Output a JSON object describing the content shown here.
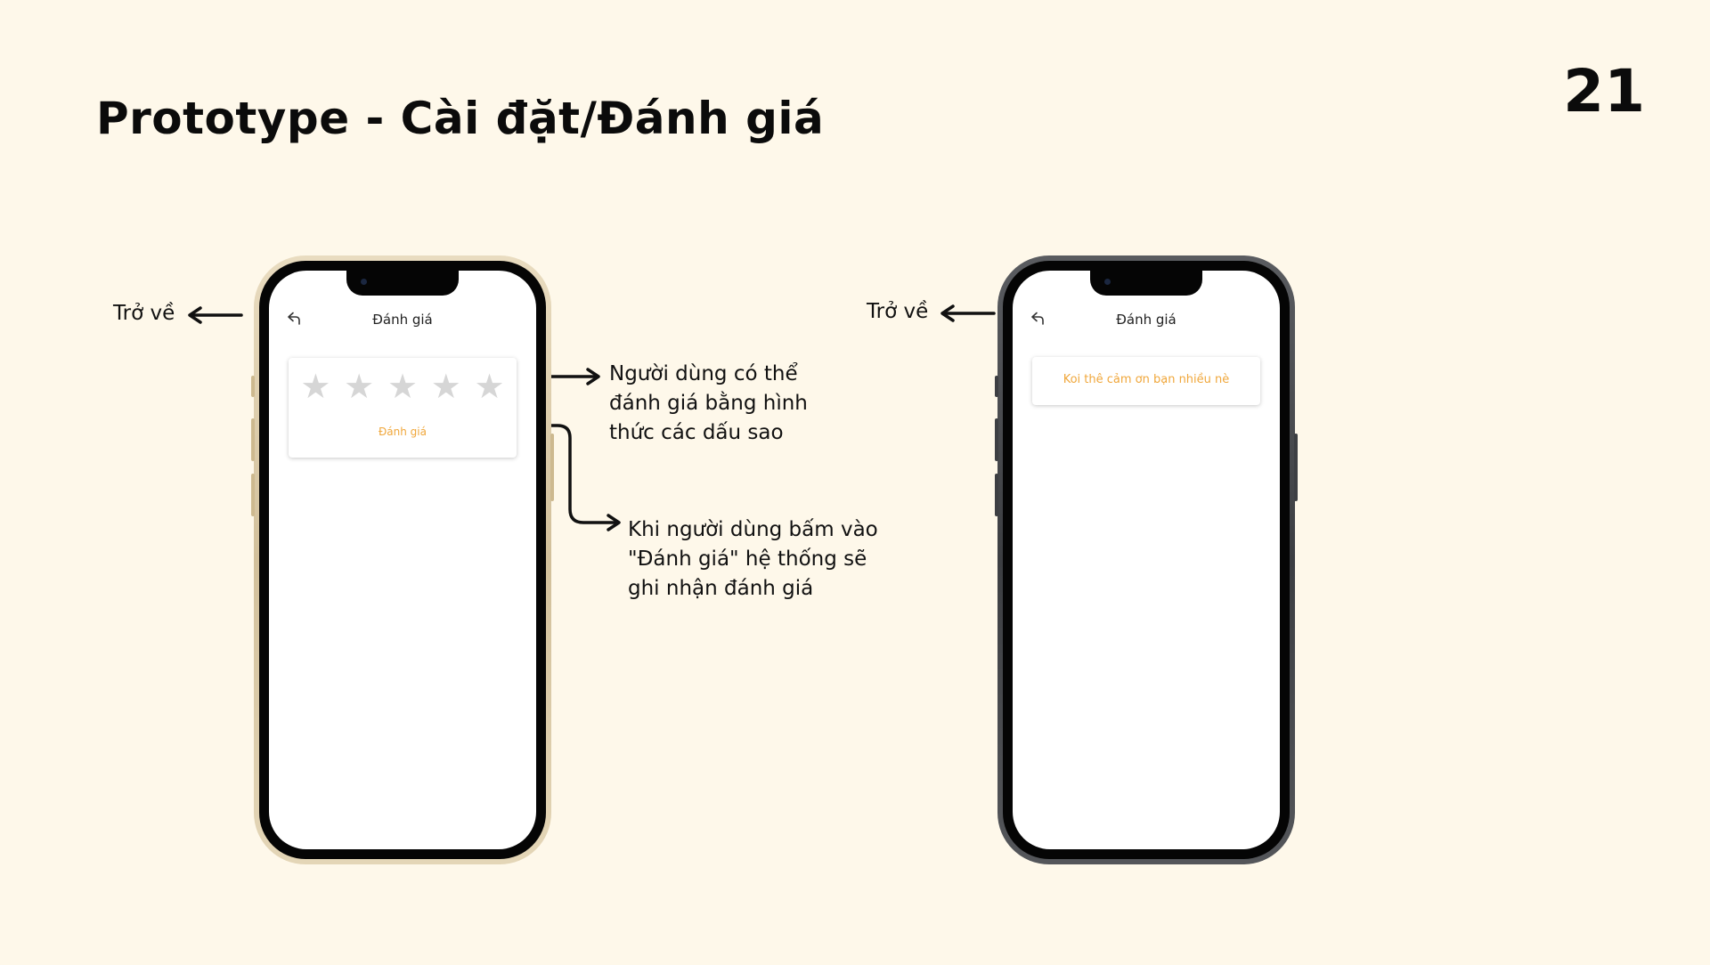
{
  "slide": {
    "title": "Prototype - Cài đặt/Đánh giá",
    "page_number": "21"
  },
  "annotations": {
    "back_left": "Trở về",
    "back_right": "Trở về",
    "stars_note": [
      "Người dùng có thể",
      "đánh giá bằng hình",
      "thức các dấu sao"
    ],
    "submit_note": [
      "Khi người dùng bấm vào",
      "\"Đánh giá\" hệ thống sẽ",
      "ghi nhận đánh giá"
    ]
  },
  "phone_rating": {
    "frame_color": "gold",
    "back_icon": "back-arrow-icon",
    "screen_title": "Đánh giá",
    "stars": [
      {
        "icon": "star-icon",
        "glyph": "★",
        "filled": false
      },
      {
        "icon": "star-icon",
        "glyph": "★",
        "filled": false
      },
      {
        "icon": "star-icon",
        "glyph": "★",
        "filled": false
      },
      {
        "icon": "star-icon",
        "glyph": "★",
        "filled": false
      },
      {
        "icon": "star-icon",
        "glyph": "★",
        "filled": false
      }
    ],
    "rating_value": 0,
    "rating_max": 5,
    "submit_label": "Đánh giá"
  },
  "phone_thanks": {
    "frame_color": "graphite",
    "back_icon": "back-arrow-icon",
    "screen_title": "Đánh giá",
    "thanks_message": "Koi thê cảm ơn bạn nhiều nè"
  },
  "colors": {
    "background": "#fef8ea",
    "accent": "#f0a73b",
    "star_empty": "#d6d6d6",
    "gold_frame": "#d2c09b",
    "graphite_frame": "#3c3e42"
  }
}
